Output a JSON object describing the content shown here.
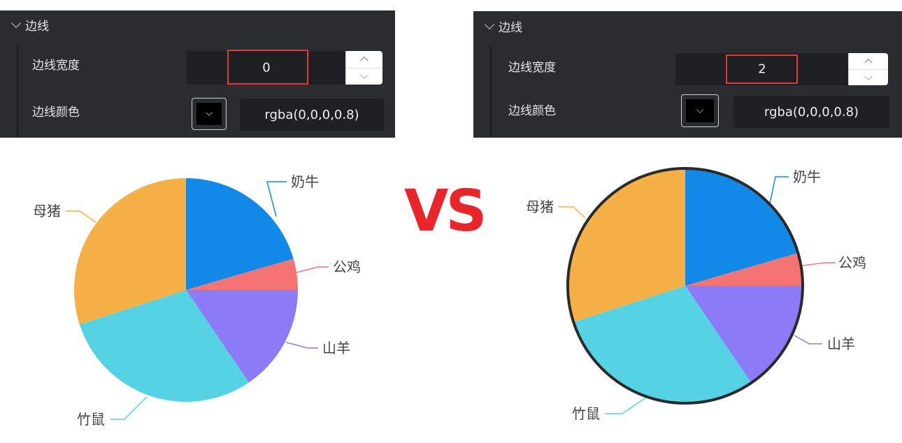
{
  "left_panel": {
    "section_title": "边线",
    "width_label": "边线宽度",
    "width_value": "0",
    "color_label": "边线颜色",
    "color_value": "rgba(0,0,0,0.8)"
  },
  "right_panel": {
    "section_title": "边线",
    "width_label": "边线宽度",
    "width_value": "2",
    "color_label": "边线颜色",
    "color_value": "rgba(0,0,0,0.8)"
  },
  "vs_text": "VS",
  "chart_data": [
    {
      "type": "pie",
      "title": "",
      "border_width": 0,
      "slices": [
        {
          "name": "奶牛",
          "value": 20.5,
          "color": "#1289e6"
        },
        {
          "name": "公鸡",
          "value": 4.5,
          "color": "#f47373"
        },
        {
          "name": "山羊",
          "value": 15.5,
          "color": "#8b7bf7"
        },
        {
          "name": "竹鼠",
          "value": 29.5,
          "color": "#55d2e4"
        },
        {
          "name": "母猪",
          "value": 30,
          "color": "#f6b146"
        }
      ]
    },
    {
      "type": "pie",
      "title": "",
      "border_width": 2,
      "border_color": "rgba(0,0,0,0.8)",
      "slices": [
        {
          "name": "奶牛",
          "value": 20.5,
          "color": "#1289e6"
        },
        {
          "name": "公鸡",
          "value": 4.5,
          "color": "#f47373"
        },
        {
          "name": "山羊",
          "value": 15.5,
          "color": "#8b7bf7"
        },
        {
          "name": "竹鼠",
          "value": 29.5,
          "color": "#55d2e4"
        },
        {
          "name": "母猪",
          "value": 30,
          "color": "#f6b146"
        }
      ]
    }
  ]
}
